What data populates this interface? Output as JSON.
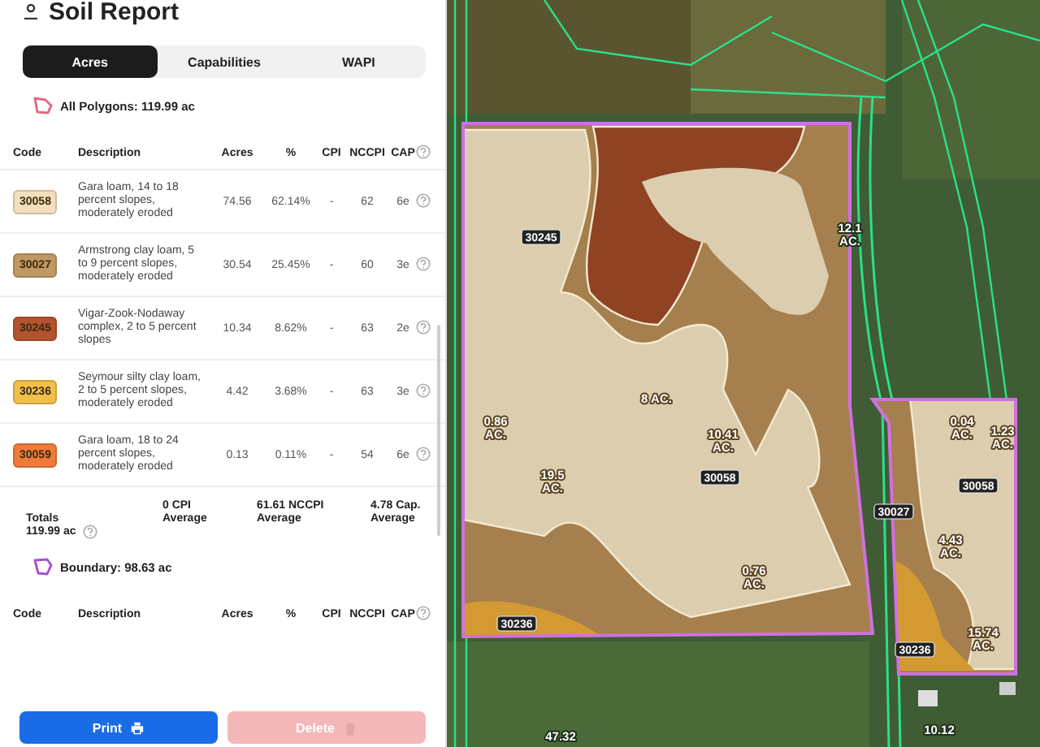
{
  "panel": {
    "title": "Soil Report",
    "tabs": [
      {
        "label": "Acres",
        "selected": true
      },
      {
        "label": "Capabilities",
        "selected": false
      },
      {
        "label": "WAPI",
        "selected": false
      }
    ],
    "sections": [
      {
        "kind": "all",
        "title": "All Polygons: 119.99 ac",
        "color": "#e06a80",
        "columns": [
          "Code",
          "Description",
          "Acres",
          "%",
          "CPI",
          "NCCPI",
          "CAP"
        ],
        "rows": [
          {
            "code": "30058",
            "color": "#f3dfbd",
            "description": "Gara loam, 14 to 18 percent slopes, moderately eroded",
            "acres": "74.56",
            "percent": "62.14%",
            "cpi": "-",
            "nccpi": "62",
            "cap": "6e"
          },
          {
            "code": "30027",
            "color": "#c09863",
            "description": "Armstrong clay loam, 5 to 9 percent slopes, moderately eroded",
            "acres": "30.54",
            "percent": "25.45%",
            "cpi": "-",
            "nccpi": "60",
            "cap": "3e"
          },
          {
            "code": "30245",
            "color": "#b5532e",
            "description": "Vigar-Zook-Nodaway complex, 2 to 5 percent slopes",
            "acres": "10.34",
            "percent": "8.62%",
            "cpi": "-",
            "nccpi": "63",
            "cap": "2e"
          },
          {
            "code": "30236",
            "color": "#f0c04a",
            "description": "Seymour silty clay loam, 2 to 5 percent slopes, moderately eroded",
            "acres": "4.42",
            "percent": "3.68%",
            "cpi": "-",
            "nccpi": "63",
            "cap": "3e"
          },
          {
            "code": "30059",
            "color": "#f07a3a",
            "description": "Gara loam, 18 to 24 percent slopes, moderately eroded",
            "acres": "0.13",
            "percent": "0.11%",
            "cpi": "-",
            "nccpi": "54",
            "cap": "6e"
          }
        ],
        "totals": {
          "label": "Totals",
          "value": "119.99 ac",
          "averages": [
            {
              "value": "0 CPI",
              "label": "Average"
            },
            {
              "value": "61.61 NCCPI",
              "label": "Average"
            },
            {
              "value": "4.78 Cap.",
              "label": "Average"
            }
          ]
        }
      },
      {
        "kind": "boundary",
        "title": "Boundary: 98.63 ac",
        "color": "#a650d0",
        "columns": [
          "Code",
          "Description",
          "Acres",
          "%",
          "CPI",
          "NCCPI",
          "CAP"
        ]
      }
    ],
    "buttons": [
      {
        "label": "Print",
        "kind": "print",
        "disabled": false
      },
      {
        "label": "Delete",
        "kind": "delete",
        "disabled": true
      }
    ]
  },
  "map": {
    "labels": [
      {
        "kind": "code",
        "text": "30245"
      },
      {
        "kind": "code",
        "text": "30058"
      },
      {
        "kind": "code",
        "text": "30236"
      },
      {
        "kind": "code",
        "text": "30027"
      },
      {
        "kind": "code",
        "text": "30058"
      },
      {
        "kind": "code",
        "text": "30236"
      },
      {
        "kind": "field",
        "text": "12.1",
        "unit": "AC."
      },
      {
        "kind": "field",
        "text": "47.32"
      },
      {
        "kind": "field",
        "text": "10.12"
      },
      {
        "kind": "area",
        "text": "8 AC."
      },
      {
        "kind": "area",
        "text": "0.86",
        "unit": "AC."
      },
      {
        "kind": "area",
        "text": "10.41",
        "unit": "AC."
      },
      {
        "kind": "area",
        "text": "19.5",
        "unit": "AC."
      },
      {
        "kind": "area",
        "text": "0.76",
        "unit": "AC."
      },
      {
        "kind": "area",
        "text": "0.04",
        "unit": "AC."
      },
      {
        "kind": "area",
        "text": "1.23",
        "unit": "AC."
      },
      {
        "kind": "area",
        "text": "4.43",
        "unit": "AC."
      },
      {
        "kind": "area",
        "text": "15.74",
        "unit": "AC."
      }
    ]
  }
}
